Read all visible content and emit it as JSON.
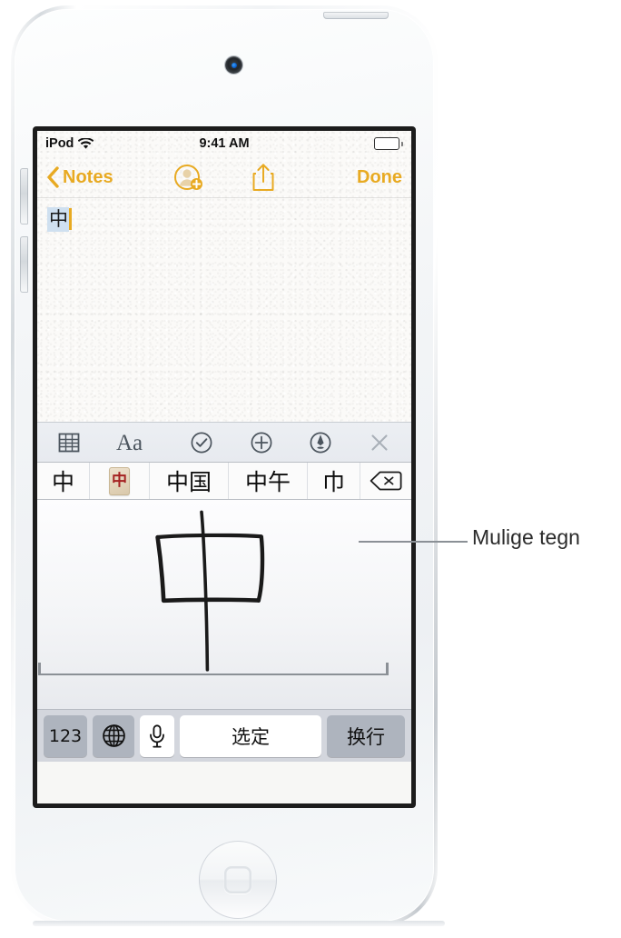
{
  "device": {
    "name": "ipod-touch-white",
    "camera_icon": "front-camera-icon",
    "home_button_icon": "home-button-icon"
  },
  "status_bar": {
    "carrier": "iPod",
    "wifi_icon": "wifi-icon",
    "time": "9:41 AM",
    "battery_icon": "battery-full-icon"
  },
  "nav_bar": {
    "back_chevron_icon": "chevron-left-icon",
    "back_label": "Notes",
    "add_people_icon": "add-person-icon",
    "share_icon": "share-icon",
    "done_label": "Done",
    "accent_color": "#e8aa22"
  },
  "note": {
    "marked_text": "中",
    "caret_color": "#e8aa22",
    "marked_highlight_color": "#cfe0f0"
  },
  "note_toolbar": {
    "items": [
      {
        "name": "table-icon",
        "label": "table"
      },
      {
        "name": "text-format-icon",
        "label": "Aa"
      },
      {
        "name": "checklist-icon",
        "label": "checkmark-circle"
      },
      {
        "name": "attach-icon",
        "label": "plus-circle"
      },
      {
        "name": "markup-pen-icon",
        "label": "pen-circle"
      },
      {
        "name": "close-icon",
        "label": "close"
      }
    ]
  },
  "candidate_bar": {
    "candidates": [
      {
        "text": "中",
        "style": "plain"
      },
      {
        "text": "中",
        "style": "mahjong-tile"
      },
      {
        "text": "中国",
        "style": "plain"
      },
      {
        "text": "中午",
        "style": "plain"
      },
      {
        "text": "巾",
        "style": "plain"
      }
    ],
    "backspace_icon": "delete-backward-icon"
  },
  "handwriting_pad": {
    "drawn_character": "中",
    "stroke_color": "#1a1a1a"
  },
  "keyboard_row": {
    "numeric_label": "123",
    "globe_icon": "globe-icon",
    "mic_icon": "microphone-icon",
    "select_label": "选定",
    "return_label": "换行",
    "key_color": "#aeb4be",
    "row_background": "#d3d6dd"
  },
  "callout": {
    "label": "Mulige tegn",
    "line_color": "#8b9096"
  }
}
